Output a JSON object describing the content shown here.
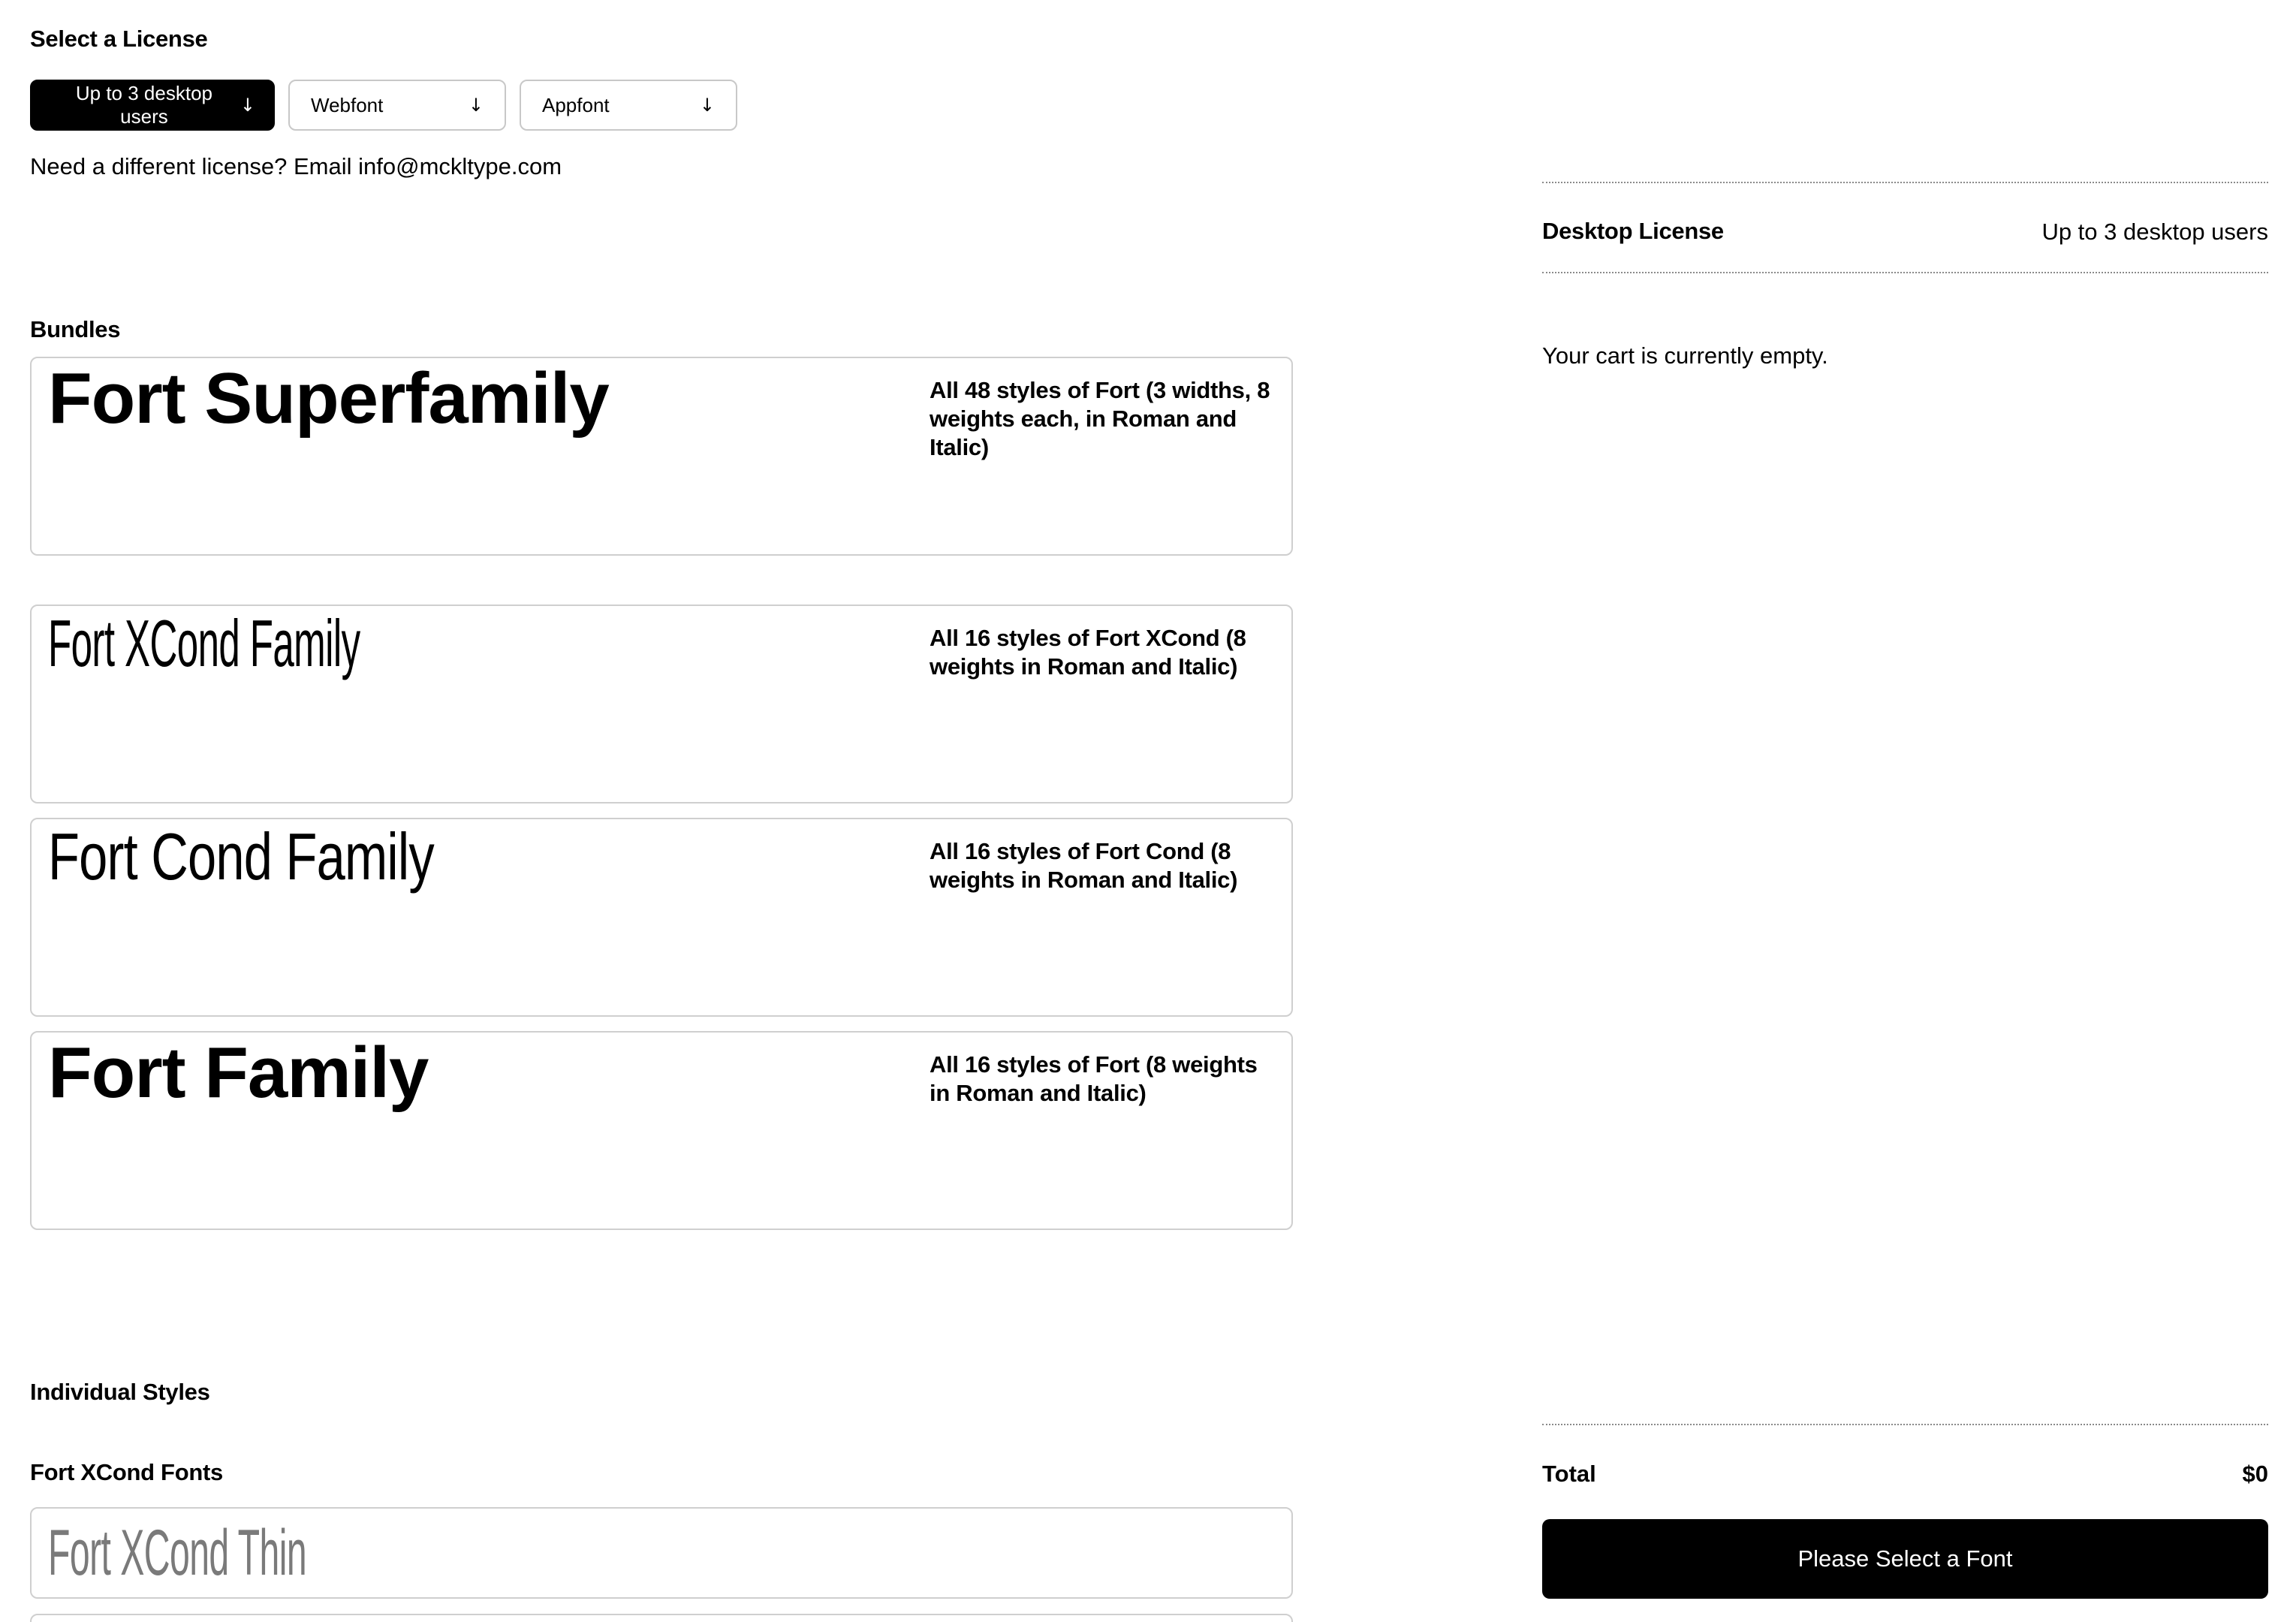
{
  "license": {
    "heading": "Select a License",
    "options": [
      {
        "label": "Up to 3 desktop users",
        "arrow": "↓",
        "selected": true
      },
      {
        "label": "Webfont",
        "arrow": "↓",
        "selected": false
      },
      {
        "label": "Appfont",
        "arrow": "↓",
        "selected": false
      }
    ],
    "note": "Need a different license? Email info@mckltype.com"
  },
  "bundles": {
    "heading": "Bundles",
    "items": [
      {
        "name": "Fort Superfamily",
        "description": "All 48 styles of Fort (3 widths, 8 weights each, in Roman and Italic)"
      },
      {
        "name": "Fort XCond Family",
        "description": "All 16 styles of Fort XCond (8 weights in Roman and Italic)"
      },
      {
        "name": "Fort Cond Family",
        "description": "All 16 styles of Fort Cond (8 weights in Roman and Italic)"
      },
      {
        "name": "Fort Family",
        "description": "All 16 styles of Fort (8 weights in Roman and Italic)"
      }
    ]
  },
  "individual": {
    "heading": "Individual Styles",
    "groups": [
      {
        "heading": "Fort XCond Fonts",
        "styles": [
          {
            "name": "Fort XCond Thin"
          },
          {
            "name": ""
          }
        ]
      }
    ]
  },
  "cart": {
    "license_label": "Desktop License",
    "license_value": "Up to 3 desktop users",
    "empty_message": "Your cart is currently empty.",
    "total_label": "Total",
    "total_value": "$0",
    "checkout_label": "Please Select a Font"
  },
  "colors": {
    "accent": "#000000",
    "background": "#ffffff",
    "border": "#cfcfcf",
    "muted_text": "#7a7a7a"
  }
}
